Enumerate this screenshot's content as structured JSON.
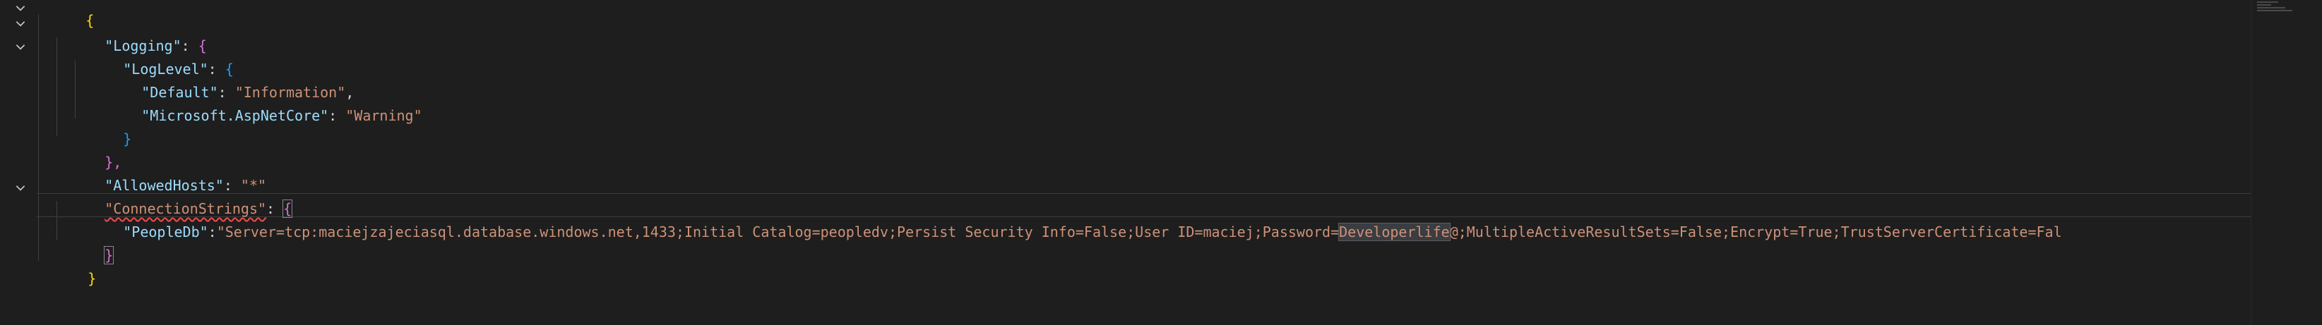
{
  "colors": {
    "background": "#1e1e1e",
    "key": "#9cdcfe",
    "string": "#ce9178",
    "punctuation": "#d4d4d4",
    "bracket_level1": "#ffd700",
    "bracket_level2": "#da70d6",
    "bracket_level3": "#179fff",
    "error_squiggle": "#f14c4c"
  },
  "icons": {
    "fold": "chevron-down-icon"
  },
  "editor": {
    "open_brace": "{",
    "logging_key": "\"Logging\"",
    "loglevel_key": "\"LogLevel\"",
    "default_key": "\"Default\"",
    "default_value": "\"Information\"",
    "ms_key": "\"Microsoft.AspNetCore\"",
    "ms_value": "\"Warning\"",
    "loglevel_close": "}",
    "logging_close": "},",
    "allowed_key": "\"AllowedHosts\"",
    "allowed_value": "\"*\"",
    "conn_key": "\"ConnectionStrings\"",
    "peopledb_key": "\"PeopleDb\"",
    "peopledb_value_prefix": "\"Server=tcp:maciejzajeciasql.database.windows.net,1433;Initial Catalog=peopledv;Persist Security Info=False;User ID=maciej;Password=",
    "peopledb_value_selected": "Developerlife",
    "peopledb_value_suffix": "@;MultipleActiveResultSets=False;Encrypt=True;TrustServerCertificate=Fal",
    "conn_close": "}",
    "root_close": "}"
  }
}
